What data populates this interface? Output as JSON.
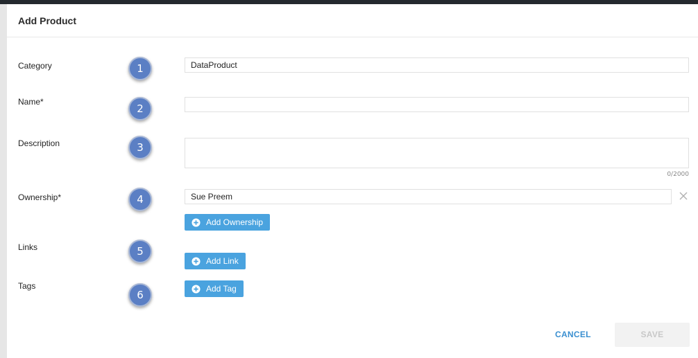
{
  "dialog": {
    "title": "Add Product",
    "cancel_label": "CANCEL",
    "save_label": "SAVE"
  },
  "badges": [
    "1",
    "2",
    "3",
    "4",
    "5",
    "6"
  ],
  "fields": {
    "category": {
      "label": "Category",
      "value": "DataProduct"
    },
    "name": {
      "label": "Name*",
      "value": ""
    },
    "description": {
      "label": "Description",
      "value": "",
      "counter": "0/2000"
    },
    "ownership": {
      "label": "Ownership*",
      "value": "Sue Preem",
      "add_label": "Add Ownership"
    },
    "links": {
      "label": "Links",
      "add_label": "Add Link"
    },
    "tags": {
      "label": "Tags",
      "add_label": "Add Tag"
    }
  },
  "colors": {
    "accent": "#4aa3df",
    "badge": "#5b7fc4",
    "cancel_text": "#3a8fd0",
    "save_disabled_bg": "#f2f2f2"
  },
  "icons": {
    "add": "plus-circle-icon",
    "clear": "close-icon"
  }
}
